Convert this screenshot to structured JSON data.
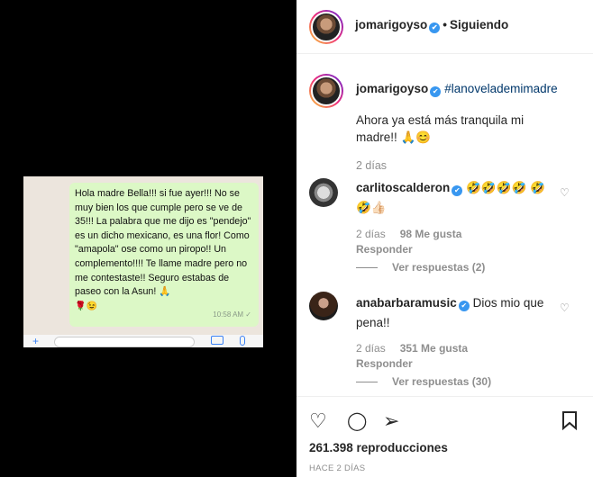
{
  "post": {
    "username": "jomarigoyso",
    "follow_status": "Siguiendo",
    "hashtag": "#lanoveladem imadre",
    "caption": "Ahora ya está más tranquila mi madre!! 🙏😊",
    "caption_time": "2 días",
    "views": "261.398 reproducciones",
    "posted_ago": "HACE 2 DÍAS"
  },
  "message": {
    "text": "Hola madre Bella!!! si fue ayer!!! No se muy bien los que cumple pero se ve de 35!!! La palabra que me dijo es \"pendejo\" es un dicho mexicano, es una flor! Como \"amapola\" ose como un piropo!! Un complemento!!!! Te llame madre pero no me contestaste!! Seguro estabas de paseo con la Asun! 🙏",
    "emojis": "🌹😉",
    "time": "10:58 AM ✓"
  },
  "comments": [
    {
      "username": "carlitoscalderon",
      "text": "🤣🤣🤣🤣 🤣🤣👍🏻",
      "time": "2 días",
      "likes": "98 Me gusta",
      "reply_label": "Responder",
      "view_replies": "Ver respuestas (2)"
    },
    {
      "username": "anabarbaramusic",
      "text": "Dios mio que pena!!",
      "time": "2 días",
      "likes": "351 Me gusta",
      "reply_label": "Responder",
      "view_replies": "Ver respuestas (30)"
    }
  ],
  "icons": {
    "verified": "✔",
    "like": "♡",
    "comment": "◯",
    "share": "➢",
    "save": "🔖"
  },
  "colors": {
    "accent_blue": "#3897f0",
    "hashtag": "#00376b",
    "bubble": "#dcf8c6"
  }
}
